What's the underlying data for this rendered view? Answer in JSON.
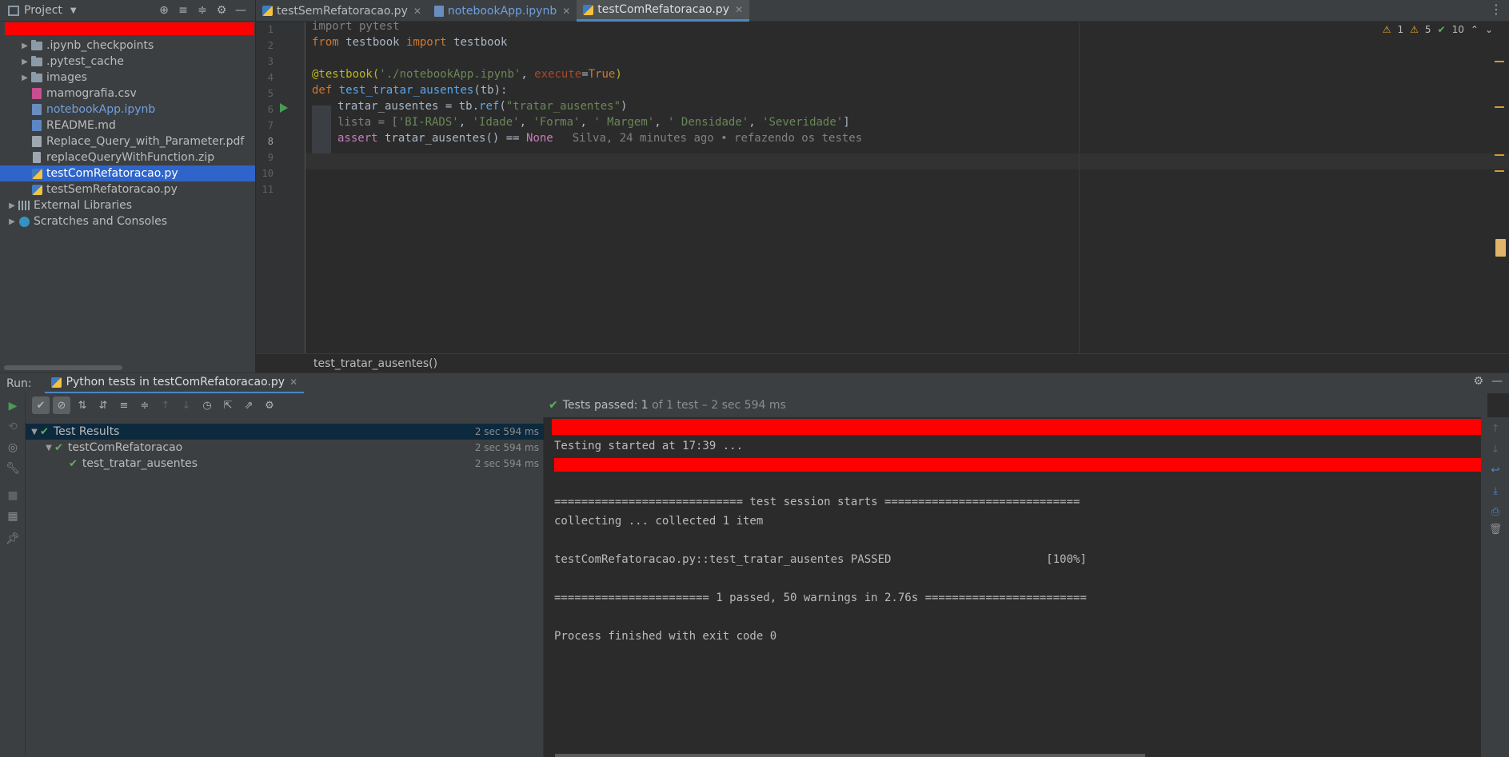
{
  "project": {
    "title": "Project",
    "tree": [
      {
        "label": ".ipynb_checkpoints",
        "icon": "folder-icon",
        "expandable": true,
        "indent": 1
      },
      {
        "label": ".pytest_cache",
        "icon": "folder-icon",
        "expandable": true,
        "indent": 1
      },
      {
        "label": "images",
        "icon": "folder-icon",
        "expandable": true,
        "indent": 1
      },
      {
        "label": "mamografia.csv",
        "icon": "csv-file-icon",
        "expandable": false,
        "indent": 1
      },
      {
        "label": "notebookApp.ipynb",
        "icon": "notebook-file-icon",
        "expandable": false,
        "indent": 1
      },
      {
        "label": "README.md",
        "icon": "markdown-file-icon",
        "expandable": false,
        "indent": 1
      },
      {
        "label": "Replace_Query_with_Parameter.pdf",
        "icon": "pdf-file-icon",
        "expandable": false,
        "indent": 1
      },
      {
        "label": "replaceQueryWithFunction.zip",
        "icon": "zip-file-icon",
        "expandable": false,
        "indent": 1
      },
      {
        "label": "testComRefatoracao.py",
        "icon": "python-file-icon",
        "expandable": false,
        "indent": 1
      },
      {
        "label": "testSemRefatoracao.py",
        "icon": "python-file-icon",
        "expandable": false,
        "indent": 1
      },
      {
        "label": "External Libraries",
        "icon": "libraries-icon",
        "expandable": true,
        "indent": 0
      },
      {
        "label": "Scratches and Consoles",
        "icon": "scratches-icon",
        "expandable": true,
        "indent": 0
      }
    ]
  },
  "tabs": [
    {
      "label": "testSemRefatoracao.py"
    },
    {
      "label": "notebookApp.ipynb"
    },
    {
      "label": "testComRefatoracao.py"
    }
  ],
  "editor": {
    "line_numbers": [
      "1",
      "2",
      "3",
      "4",
      "5",
      "6",
      "7",
      "8",
      "9",
      "10",
      "11"
    ],
    "inspections": {
      "errors": "1",
      "warnings": "5",
      "ok": "10"
    },
    "code": {
      "l1": "import pytest",
      "l2_from": "from",
      "l2_mod": " testbook ",
      "l2_import": "import",
      "l2_name": " testbook",
      "l4_dec": "@testbook(",
      "l4_str": "'./notebookApp.ipynb'",
      "l4_comma": ", ",
      "l4_param": "execute",
      "l4_eq": "=",
      "l4_true": "True",
      "l4_close": ")",
      "l5_def": "def",
      "l5_fn": " test_tratar_ausentes",
      "l5_args": "(tb):",
      "l6_a": "tratar_ausentes = tb.",
      "l6_ref": "ref",
      "l6_open": "(",
      "l6_str": "\"tratar_ausentes\"",
      "l6_close": ")",
      "l7_a": "lista = [",
      "l7_s1": "'BI-RADS'",
      "l7_s2": "'Idade'",
      "l7_s3": "'Forma'",
      "l7_s4": "' Margem'",
      "l7_s5": "' Densidade'",
      "l7_s6": "'Severidade'",
      "l7_close": "]",
      "l8_assert": "assert",
      "l8_call": " tratar_ausentes() == ",
      "l8_none": "None",
      "l8_blame": "Silva, 24 minutes ago • refazendo os testes"
    },
    "breadcrumb": "test_tratar_ausentes()"
  },
  "run": {
    "label": "Run:",
    "tab_label": "Python tests in testComRefatoracao.py",
    "status_title": "Tests passed:",
    "status_count": "1",
    "status_detail": "of 1 test – 2 sec 594 ms",
    "results": [
      {
        "label": "Test Results",
        "time": "2 sec 594 ms",
        "indent": 0
      },
      {
        "label": "testComRefatoracao",
        "time": "2 sec 594 ms",
        "indent": 1
      },
      {
        "label": "test_tratar_ausentes",
        "time": "2 sec 594 ms",
        "indent": 2
      }
    ],
    "console": {
      "l1": "Testing started at 17:39 ...",
      "l2": "============================ test session starts =============================",
      "l3": "collecting ... collected 1 item",
      "l4": "testComRefatoracao.py::test_tratar_ausentes PASSED                       [100%]",
      "l5": "======================= 1 passed, 50 warnings in 2.76s ========================",
      "l6": "Process finished with exit code 0"
    }
  }
}
